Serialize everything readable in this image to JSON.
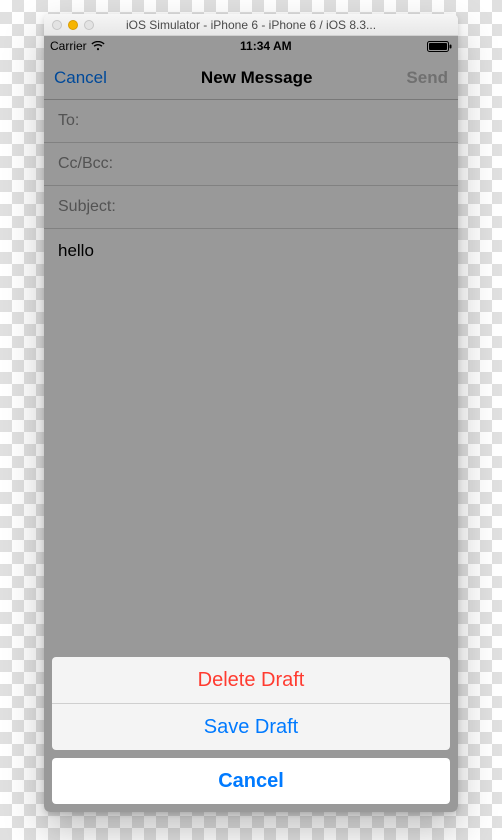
{
  "window": {
    "title": "iOS Simulator - iPhone 6 - iPhone 6 / iOS 8.3..."
  },
  "statusBar": {
    "carrier": "Carrier",
    "time": "11:34 AM"
  },
  "navBar": {
    "cancel": "Cancel",
    "title": "New Message",
    "send": "Send"
  },
  "compose": {
    "toLabel": "To:",
    "ccBccLabel": "Cc/Bcc:",
    "subjectLabel": "Subject:",
    "body": "hello"
  },
  "actionSheet": {
    "deleteDraft": "Delete Draft",
    "saveDraft": "Save Draft",
    "cancel": "Cancel"
  }
}
